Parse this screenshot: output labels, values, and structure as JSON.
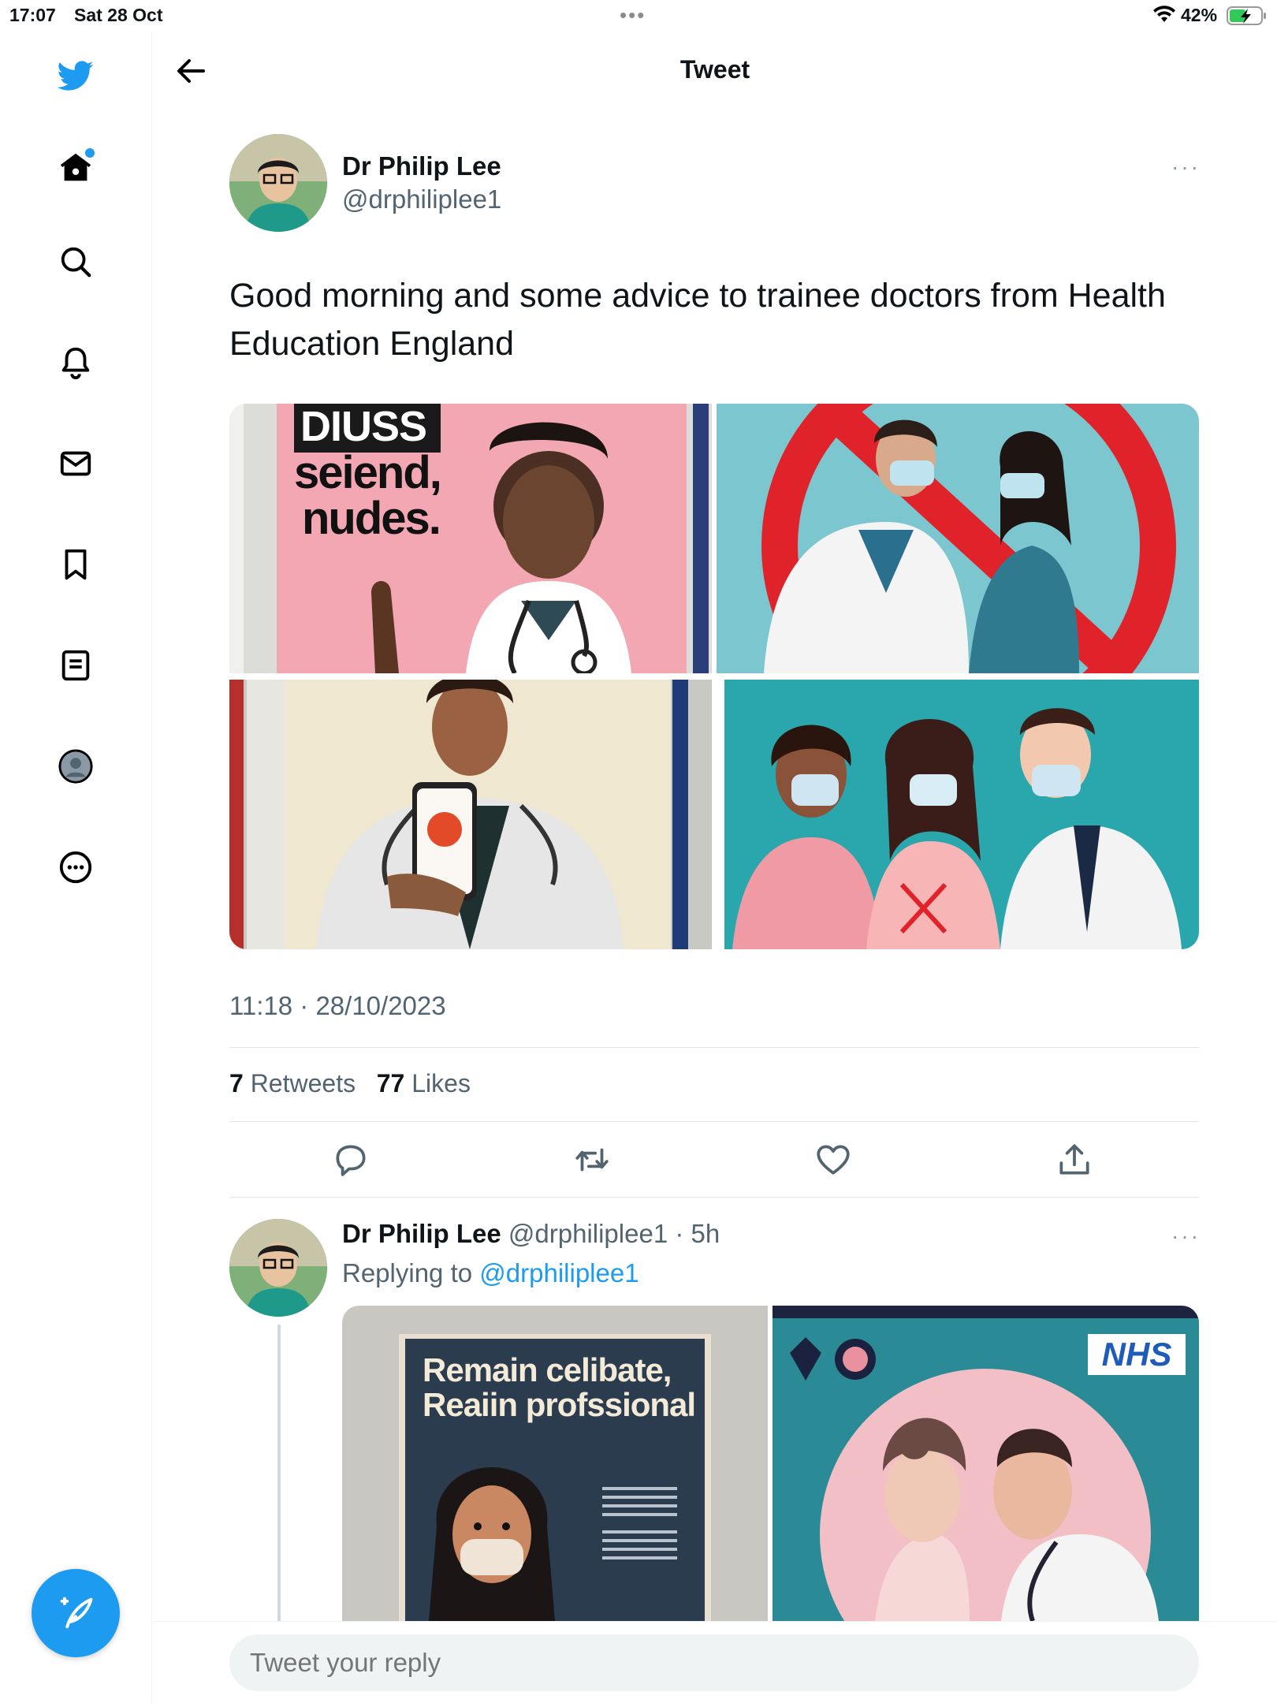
{
  "status_bar": {
    "time": "17:07",
    "date": "Sat 28 Oct",
    "battery_pct": "42%"
  },
  "header": {
    "title": "Tweet"
  },
  "tweet": {
    "author_name": "Dr Philip Lee",
    "author_handle": "@drphiliplee1",
    "more": "···",
    "text": "Good morning and some advice to trainee doctors from Health Education England",
    "images": {
      "img1_line1": "DIUSS",
      "img1_line2": "seiend,",
      "img1_line3": "nudes."
    },
    "timestamp": "11:18 · 28/10/2023",
    "retweets_count": "7",
    "retweets_label": "Retweets",
    "likes_count": "77",
    "likes_label": "Likes"
  },
  "reply": {
    "author_name": "Dr Philip Lee",
    "author_handle": "@drphiliplee1",
    "time": "· 5h",
    "replying_prefix": "Replying to",
    "replying_handle": "@drphiliplee1",
    "more": "···",
    "poster_line1": "Remain celibate,",
    "poster_line2": "Reaiin profssional",
    "poster2_badge": "NHS"
  },
  "reply_box": {
    "placeholder": "Tweet your reply"
  },
  "colors": {
    "accent": "#1d9bf0",
    "text_secondary": "#536471"
  },
  "icons": [
    "twitter-logo-icon",
    "home-icon",
    "search-icon",
    "bell-icon",
    "mail-icon",
    "bookmark-icon",
    "lists-icon",
    "profile-icon",
    "more-circle-icon",
    "compose-icon",
    "back-arrow-icon",
    "reply-icon",
    "retweet-icon",
    "like-icon",
    "share-icon"
  ]
}
